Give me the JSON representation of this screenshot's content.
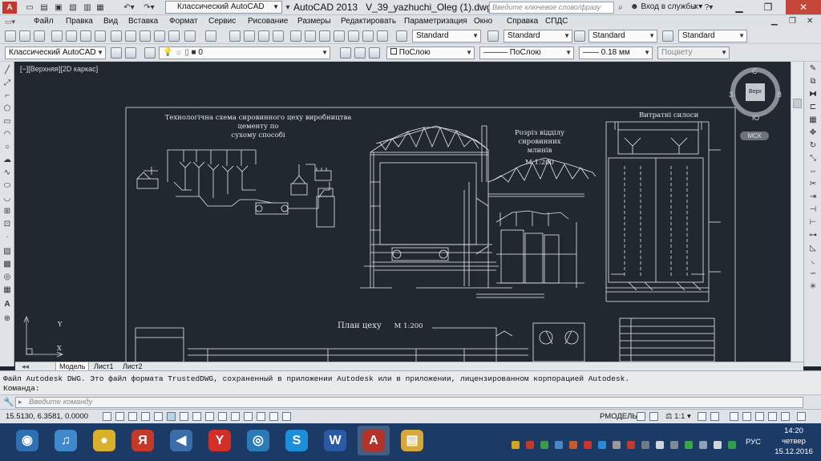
{
  "app": {
    "workspace": "Классический AutoCAD",
    "title_app": "AutoCAD 2013",
    "title_file": "V_39_yazhuchi_Oleg (1).dwg",
    "search_placeholder": "Введите ключевое слово/фразу",
    "login": "Вход в службы"
  },
  "menu": [
    "Файл",
    "Правка",
    "Вид",
    "Вставка",
    "Формат",
    "Сервис",
    "Рисование",
    "Размеры",
    "Редактировать",
    "Параметризация",
    "Окно",
    "Справка",
    "СПДС"
  ],
  "toolbars": {
    "styles": [
      "Standard",
      "Standard",
      "Standard",
      "Standard"
    ],
    "workspace2": "Классический AutoCAD",
    "layer": "0",
    "color": "ПоСлою",
    "linetype": "ПоСлою",
    "lineweight": "0.18 мм",
    "plotstyle": "Поцвету"
  },
  "viewport": {
    "label": "[−][Верхняя][2D каркас]",
    "compass": {
      "n": "С",
      "s": "Ю",
      "w": "З",
      "e": "В",
      "face": "Верх"
    },
    "wcs": "МСК"
  },
  "drawing": {
    "text1_l1": "Технологічна схема сировинного цеху виробництва цементу по",
    "text1_l2": "сухому способі",
    "text2_l1": "Розріз відділу сировинних",
    "text2_l2": "млинів",
    "text2_scale": "М 1:200",
    "text3": "Витратні силоси",
    "text4": "План цеху",
    "text4_scale": "М 1:200"
  },
  "layout_tabs": [
    "Модель",
    "Лист1",
    "Лист2"
  ],
  "command": {
    "line1": "Файл Autodesk DWG. Это файл формата TrustedDWG, сохраненный в приложении Autodesk или в приложении, лицензированном корпорацией Autodesk.",
    "line2": "Команда:",
    "placeholder": "Введите команду"
  },
  "status": {
    "coords": "15.5130, 6.3581, 0.0000",
    "model": "РМОДЕЛЬ",
    "scale": "1:1"
  },
  "taskbar": {
    "apps": [
      {
        "name": "owl",
        "color": "#2f6fb3",
        "glyph": "◉"
      },
      {
        "name": "itunes",
        "color": "#3f88c9",
        "glyph": "♫"
      },
      {
        "name": "chrome",
        "color": "#d9b12a",
        "glyph": "●"
      },
      {
        "name": "yandex-browser",
        "color": "#c43a2a",
        "glyph": "Я"
      },
      {
        "name": "audio",
        "color": "#3b6ea8",
        "glyph": "◀"
      },
      {
        "name": "yandex",
        "color": "#d12f27",
        "glyph": "Y"
      },
      {
        "name": "media",
        "color": "#2a7bb8",
        "glyph": "◎"
      },
      {
        "name": "skype",
        "color": "#1d8fd8",
        "glyph": "S"
      },
      {
        "name": "word",
        "color": "#2a5aa6",
        "glyph": "W"
      },
      {
        "name": "autocad",
        "color": "#b3332b",
        "glyph": "A"
      },
      {
        "name": "explorer",
        "color": "#d4a83d",
        "glyph": "▤"
      }
    ],
    "lang": "РУС",
    "time": "14:20",
    "day": "четвер",
    "date": "15.12.2016"
  }
}
